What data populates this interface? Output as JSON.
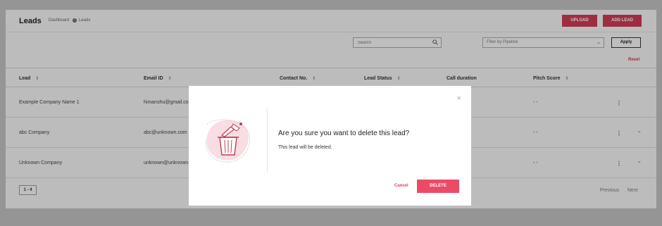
{
  "header": {
    "title": "Leads",
    "breadcrumb": {
      "parent": "Dashboard",
      "current": "Leads",
      "separator_icon": "info-circle-icon"
    },
    "upload_label": "UPLOAD",
    "add_lead_label": "ADD LEAD"
  },
  "toolbar": {
    "search_placeholder": "Search",
    "filter_placeholder": "Filter by Pipeline",
    "apply_label": "Apply",
    "reset_label": "Reset"
  },
  "table": {
    "columns": [
      "Lead",
      "Email ID",
      "Contact No.",
      "Lead Status",
      "Call duration",
      "Pitch Score"
    ],
    "rows": [
      {
        "lead": "Example Company Name 1",
        "email": "himanshu@gmail.co",
        "pitch": "- -"
      },
      {
        "lead": "abc Company",
        "email": "abc@unknown.com",
        "pitch": "- -"
      },
      {
        "lead": "Unknown Company",
        "email": "unknown@unknown.",
        "pitch": "- -"
      }
    ]
  },
  "pagination": {
    "range": "1 - 4",
    "previous": "Previous",
    "next": "Next"
  },
  "modal": {
    "heading": "Are you sure you want to delete this lead?",
    "message": "This lead will be deleted.",
    "cancel_label": "Cancel",
    "delete_label": "DELETE",
    "close_icon": "close-icon",
    "illustration": "trash-bin-illustration"
  },
  "colors": {
    "accent": "#c93b52",
    "delete_button": "#ec4b68",
    "cancel_text": "#d9435c"
  }
}
